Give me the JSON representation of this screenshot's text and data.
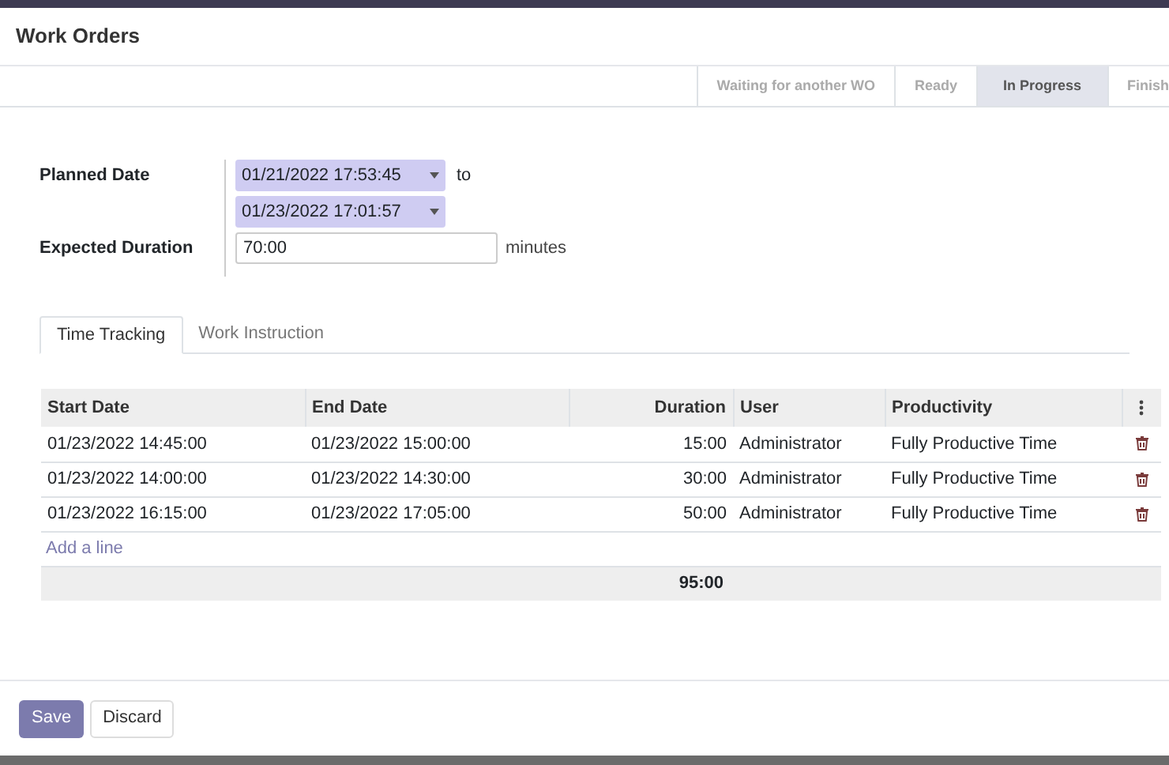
{
  "dialog": {
    "title": "Work Orders"
  },
  "stages": [
    {
      "label": "Waiting for another WO",
      "selected": false
    },
    {
      "label": "Ready",
      "selected": false
    },
    {
      "label": "In Progress",
      "selected": true
    },
    {
      "label": "Finish",
      "selected": false
    }
  ],
  "form": {
    "planned_date": {
      "label": "Planned Date",
      "start": "01/21/2022 17:53:45",
      "separator": "to",
      "end": "01/23/2022 17:01:57"
    },
    "expected_duration": {
      "label": "Expected Duration",
      "value": "70:00",
      "unit": "minutes"
    }
  },
  "tabs": [
    {
      "label": "Time Tracking",
      "selected": true
    },
    {
      "label": "Work Instruction",
      "selected": false
    }
  ],
  "table": {
    "columns": [
      "Start Date",
      "End Date",
      "Duration",
      "User",
      "Productivity"
    ],
    "rows": [
      {
        "start": "01/23/2022 14:45:00",
        "end": "01/23/2022 15:00:00",
        "duration": "15:00",
        "user": "Administrator",
        "productivity": "Fully Productive Time"
      },
      {
        "start": "01/23/2022 14:00:00",
        "end": "01/23/2022 14:30:00",
        "duration": "30:00",
        "user": "Administrator",
        "productivity": "Fully Productive Time"
      },
      {
        "start": "01/23/2022 16:15:00",
        "end": "01/23/2022 17:05:00",
        "duration": "50:00",
        "user": "Administrator",
        "productivity": "Fully Productive Time"
      }
    ],
    "add_line": "Add a line",
    "total_duration": "95:00"
  },
  "buttons": [
    {
      "label": "Save",
      "kind": "primary"
    },
    {
      "label": "Discard",
      "kind": "secondary"
    }
  ]
}
